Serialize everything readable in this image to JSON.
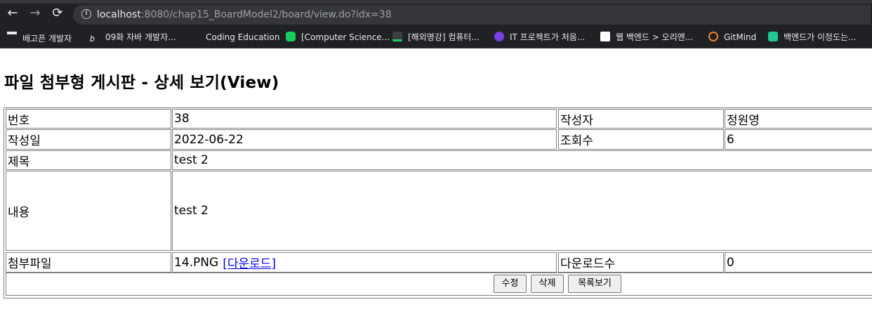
{
  "browser": {
    "url_host": "localhost",
    "url_rest": ":8080/chap15_BoardModel2/board/view.do?idx=38",
    "nav_back": "←",
    "nav_forward": "→",
    "nav_reload": "⟳",
    "info_glyph": "i"
  },
  "bookmarks": [
    {
      "label": "배고픈 개발자",
      "icon": "graduation-cap-icon",
      "color": "#e8eaed"
    },
    {
      "label": "09화 자바 개발자...",
      "icon": "brunch-icon",
      "color": "#e8eaed"
    },
    {
      "label": "Coding Education",
      "icon": "blank-icon",
      "color": "#202124"
    },
    {
      "label": "[Computer Science...",
      "icon": "blog-icon",
      "color": "#19ce60"
    },
    {
      "label": "[해외명강] 컴퓨터...",
      "icon": "terminal-icon",
      "color": "#3c4043"
    },
    {
      "label": "IT 프로젝트가 처음...",
      "icon": "hexagon-icon",
      "color": "#7b3fe4"
    },
    {
      "label": "웹 백엔드 > 오리엔...",
      "icon": "boostcourse-icon",
      "color": "#ffffff"
    },
    {
      "label": "GitMind",
      "icon": "gitmind-icon",
      "color": "#f5822a"
    },
    {
      "label": "백엔드가 이정도는...",
      "icon": "velog-icon",
      "color": "#20c997"
    }
  ],
  "page": {
    "title": "파일 첨부형 게시판 - 상세 보기(View)"
  },
  "post": {
    "number_label": "번호",
    "number": "38",
    "writer_label": "작성자",
    "writer": "정원영",
    "date_label": "작성일",
    "date": "2022-06-22",
    "views_label": "조회수",
    "views": "6",
    "subject_label": "제목",
    "subject": "test 2",
    "content_label": "내용",
    "content": "test 2",
    "attachment_label": "첨부파일",
    "attachment_name": "14.PNG",
    "download_link": "[다운로드]",
    "download_count_label": "다운로드수",
    "download_count": "0"
  },
  "buttons": {
    "edit": "수정",
    "delete": "삭제",
    "list": "목록보기"
  }
}
